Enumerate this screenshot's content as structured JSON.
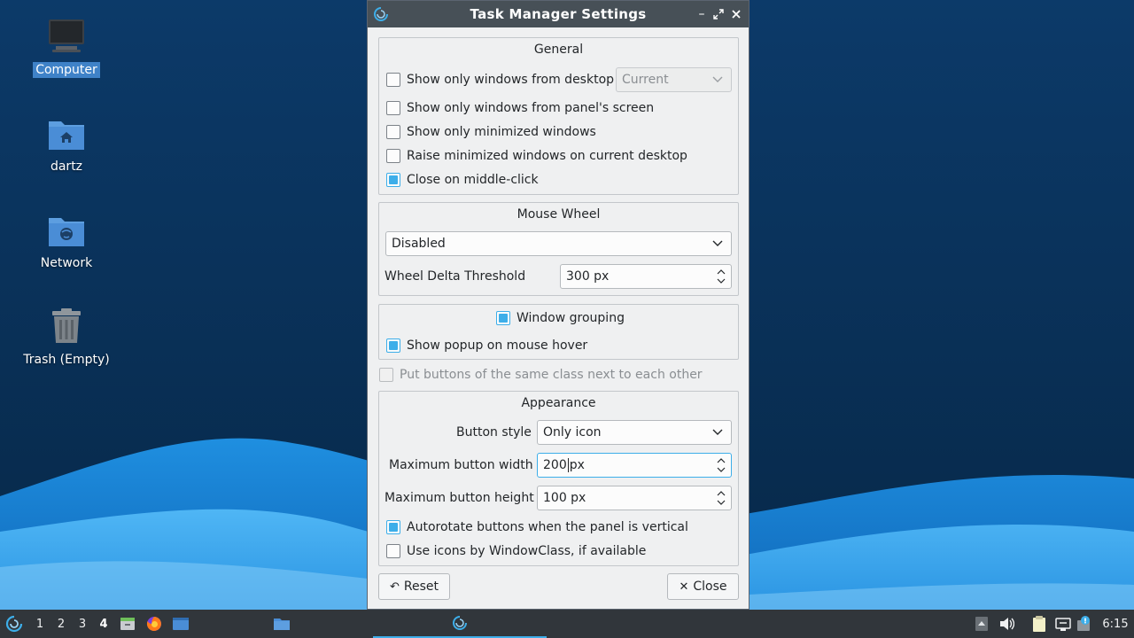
{
  "desktop": {
    "icons": [
      {
        "label": "Computer",
        "icon": "computer-icon",
        "selected": true
      },
      {
        "label": "dartz",
        "icon": "home-folder-icon"
      },
      {
        "label": "Network",
        "icon": "network-folder-icon"
      },
      {
        "label": "Trash (Empty)",
        "icon": "trash-icon"
      }
    ]
  },
  "dialog": {
    "title": "Task Manager Settings",
    "general": {
      "title": "General",
      "show_from_desktop": {
        "label": "Show only windows from desktop",
        "checked": false
      },
      "desktop_combo": {
        "value": "Current"
      },
      "show_from_screen": {
        "label": "Show only windows from panel's screen",
        "checked": false
      },
      "show_minimized": {
        "label": "Show only minimized windows",
        "checked": false
      },
      "raise_minimized": {
        "label": "Raise minimized windows on current desktop",
        "checked": false
      },
      "close_middle": {
        "label": "Close on middle-click",
        "checked": true
      }
    },
    "mouse_wheel": {
      "title": "Mouse Wheel",
      "mode": {
        "value": "Disabled"
      },
      "threshold_label": "Wheel Delta Threshold",
      "threshold_value": "300 px"
    },
    "grouping": {
      "label": "Window grouping",
      "checked": true,
      "popup": {
        "label": "Show popup on mouse hover",
        "checked": true
      }
    },
    "same_class": {
      "label": "Put buttons of the same class next to each other",
      "checked": false,
      "disabled": true
    },
    "appearance": {
      "title": "Appearance",
      "style_label": "Button style",
      "style_value": "Only icon",
      "width_label": "Maximum button width",
      "width_value": "200",
      "width_unit": "px",
      "height_label": "Maximum button height",
      "height_value": "100 px",
      "autorotate": {
        "label": "Autorotate buttons when the panel is vertical",
        "checked": true
      },
      "windowclass": {
        "label": "Use icons by WindowClass, if available",
        "checked": false
      }
    },
    "buttons": {
      "reset": "Reset",
      "close": "Close"
    }
  },
  "taskbar": {
    "workspaces": [
      "1",
      "2",
      "3",
      "4"
    ],
    "active_workspace": "4",
    "clock": "6:15"
  },
  "colors": {
    "accent": "#3daee9",
    "titlebar": "#475057",
    "panel": "#31363b",
    "dialog_bg": "#eff0f1"
  }
}
